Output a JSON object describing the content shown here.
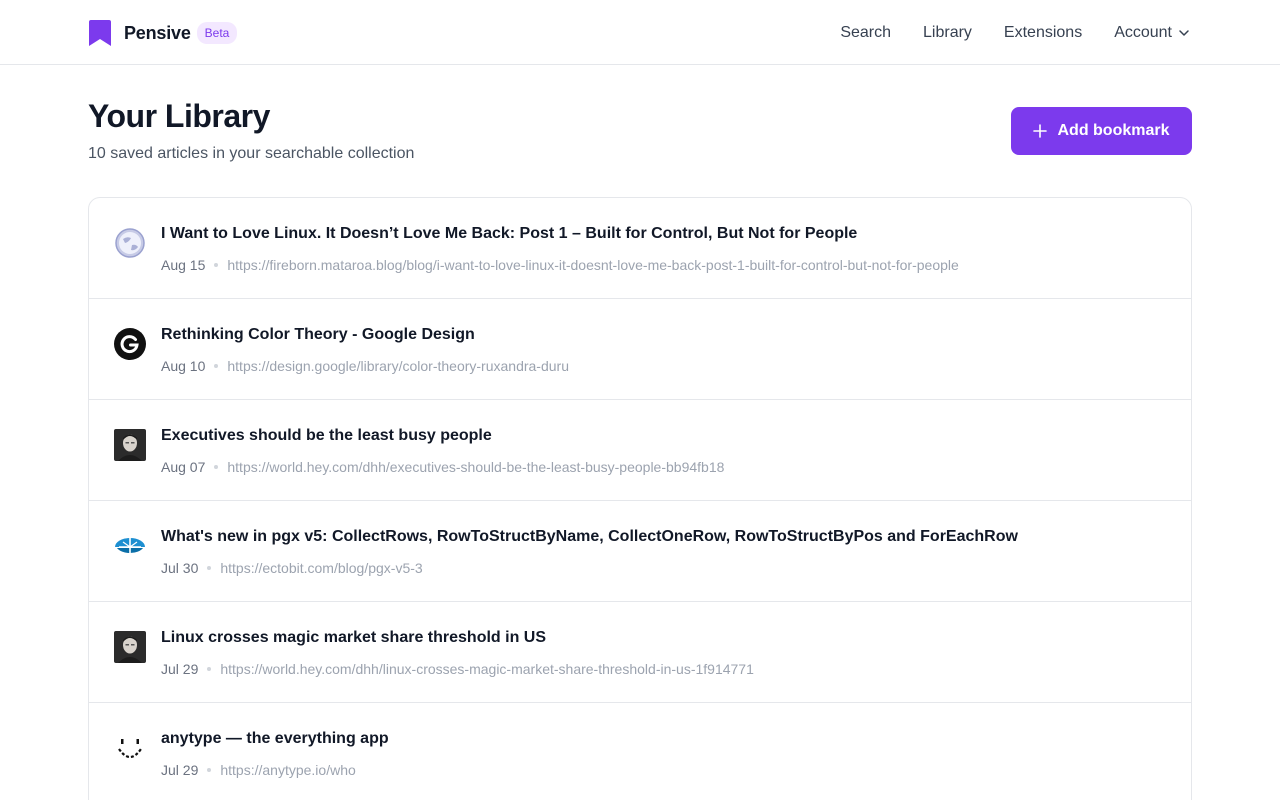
{
  "brand": {
    "name": "Pensive",
    "badge": "Beta",
    "accent": "#7c3aed"
  },
  "nav": {
    "items": [
      {
        "label": "Search"
      },
      {
        "label": "Library"
      },
      {
        "label": "Extensions"
      }
    ],
    "account_label": "Account"
  },
  "page": {
    "title": "Your Library",
    "subtitle": "10 saved articles in your searchable collection",
    "add_button_label": "Add bookmark"
  },
  "bookmarks": [
    {
      "title": "I Want to Love Linux. It Doesn’t Love Me Back: Post 1 – Built for Control, But Not for People",
      "date": "Aug 15",
      "url": "https://fireborn.mataroa.blog/blog/i-want-to-love-linux-it-doesnt-love-me-back-post-1-built-for-control-but-not-for-people",
      "icon": "globe-icon"
    },
    {
      "title": "Rethinking Color Theory - Google Design",
      "date": "Aug 10",
      "url": "https://design.google/library/color-theory-ruxandra-duru",
      "icon": "google-g-icon"
    },
    {
      "title": "Executives should be the least busy people",
      "date": "Aug 07",
      "url": "https://world.hey.com/dhh/executives-should-be-the-least-busy-people-bb94fb18",
      "icon": "author-avatar-icon"
    },
    {
      "title": "What's new in pgx v5: CollectRows, RowToStructByName, CollectOneRow, RowToStructByPos and ForEachRow",
      "date": "Jul 30",
      "url": "https://ectobit.com/blog/pgx-v5-3",
      "icon": "ectobit-logo-icon"
    },
    {
      "title": "Linux crosses magic market share threshold in US",
      "date": "Jul 29",
      "url": "https://world.hey.com/dhh/linux-crosses-magic-market-share-threshold-in-us-1f914771",
      "icon": "author-avatar-icon"
    },
    {
      "title": "anytype — the everything app",
      "date": "Jul 29",
      "url": "https://anytype.io/who",
      "icon": "anytype-smile-icon"
    }
  ]
}
